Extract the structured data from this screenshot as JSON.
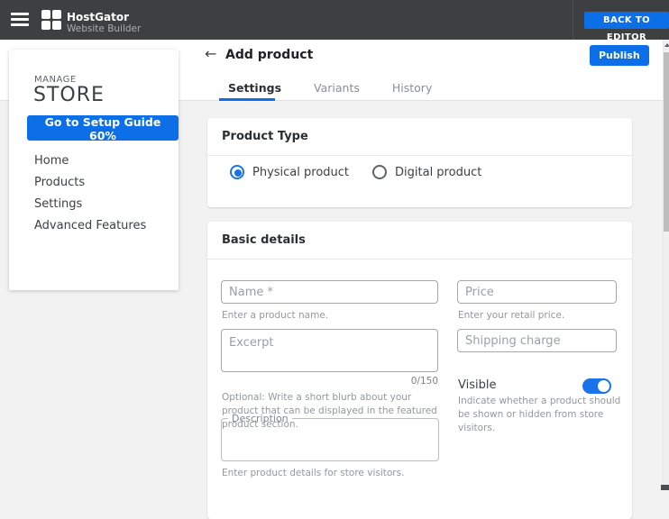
{
  "topbar": {
    "brand_name": "HostGator",
    "brand_sub": "Website Builder",
    "back_to_editor": "BACK TO EDITOR"
  },
  "sidebar": {
    "eyebrow": "MANAGE",
    "title": "STORE",
    "setup_button": "Go to Setup Guide 60%",
    "items": [
      {
        "label": "Home"
      },
      {
        "label": "Products"
      },
      {
        "label": "Settings"
      },
      {
        "label": "Advanced Features"
      }
    ]
  },
  "header": {
    "title": "Add product",
    "publish_label": "Publish",
    "tabs": [
      {
        "label": "Settings",
        "active": true
      },
      {
        "label": "Variants",
        "active": false
      },
      {
        "label": "History",
        "active": false
      }
    ]
  },
  "product_type": {
    "title": "Product Type",
    "options": [
      {
        "label": "Physical product",
        "selected": true
      },
      {
        "label": "Digital product",
        "selected": false
      }
    ]
  },
  "basic_details": {
    "title": "Basic details",
    "name": {
      "placeholder": "Name *",
      "helper": "Enter a product name."
    },
    "price": {
      "placeholder": "Price",
      "helper": "Enter your retail price."
    },
    "excerpt": {
      "placeholder": "Excerpt",
      "counter": "0/150",
      "helper": "Optional: Write a short blurb about your product that can be displayed in the featured product section."
    },
    "shipping": {
      "placeholder": "Shipping charge"
    },
    "visible": {
      "label": "Visible",
      "state": "on",
      "helper": "Indicate whether a product should be shown or hidden from store visitors."
    },
    "description": {
      "label": "Description",
      "helper": "Enter product details for store visitors."
    }
  },
  "colors": {
    "accent_blue": "#0d6fe8",
    "control_blue": "#1a73e8",
    "topbar_bg": "#3d3f41",
    "content_bg": "#f2f2f2"
  }
}
